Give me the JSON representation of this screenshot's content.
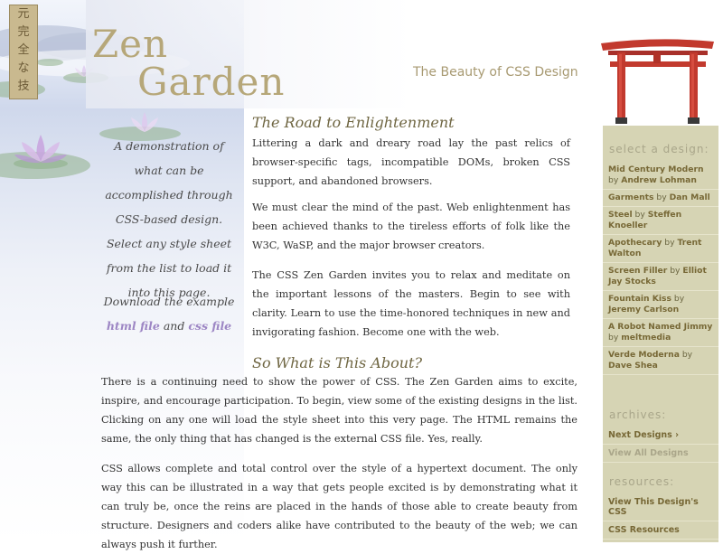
{
  "seal": {
    "chars": [
      "元",
      "完",
      "全",
      "な",
      "技"
    ]
  },
  "header": {
    "logo_line1": "Zen",
    "logo_line2": "Garden",
    "tagline": "The Beauty of CSS Design"
  },
  "intro": {
    "text": "A demonstration of what can be accomplished through CSS-based design. Select any style sheet from the list to load it into this page.",
    "download_prefix": "Download the example",
    "html_link": "html file",
    "and": "and",
    "css_link": "css file"
  },
  "main": {
    "road_heading": "The Road to Enlightenment",
    "road_p1": "Littering a dark and dreary road lay the past relics of browser-specific tags, incompatible DOMs, broken CSS support, and abandoned browsers.",
    "road_p2": "We must clear the mind of the past. Web enlightenment has been achieved thanks to the tireless efforts of folk like the W3C, WaSP, and the major browser creators.",
    "road_p3": "The CSS Zen Garden invites you to relax and meditate on the important lessons of the masters. Begin to see with clarity. Learn to use the time-honored techniques in new and invigorating fashion. Become one with the web.",
    "about_heading": "So What is This About?",
    "about_p1": "There is a continuing need to show the power of CSS. The Zen Garden aims to excite, inspire, and encourage participation. To begin, view some of the existing designs in the list. Clicking on any one will load the style sheet into this very page. The HTML remains the same, the only thing that has changed is the external CSS file. Yes, really.",
    "about_p2": "CSS allows complete and total control over the style of a hypertext document. The only way this can be illustrated in a way that gets people excited is by demonstrating what it can truly be, once the reins are placed in the hands of those able to create beauty from structure. Designers and coders alike have contributed to the beauty of the web; we can always push it further."
  },
  "sidebar": {
    "select_title": "select a design:",
    "designs": [
      {
        "name": "Mid Century Modern",
        "by": "by",
        "author": "Andrew Lohman"
      },
      {
        "name": "Garments",
        "by": "by",
        "author": "Dan Mall"
      },
      {
        "name": "Steel",
        "by": "by",
        "author": "Steffen Knoeller"
      },
      {
        "name": "Apothecary",
        "by": "by",
        "author": "Trent Walton"
      },
      {
        "name": "Screen Filler",
        "by": "by",
        "author": "Elliot Jay Stocks"
      },
      {
        "name": "Fountain Kiss",
        "by": "by",
        "author": "Jeremy Carlson"
      },
      {
        "name": "A Robot Named Jimmy",
        "by": "by",
        "author": "meltmedia"
      },
      {
        "name": "Verde Moderna",
        "by": "by",
        "author": "Dave Shea"
      }
    ],
    "archives_title": "archives:",
    "next_designs": "Next Designs ›",
    "view_all": "View All Designs",
    "resources_title": "resources:",
    "view_source": "View This Design's CSS",
    "css_resources": "CSS Resources"
  },
  "colors": {
    "heading": "#6f6642",
    "logo": "#b6a779",
    "link_purple": "#9d86c4",
    "sidebar_bg": "#d6d4b4",
    "torii_red": "#c23a2e"
  }
}
